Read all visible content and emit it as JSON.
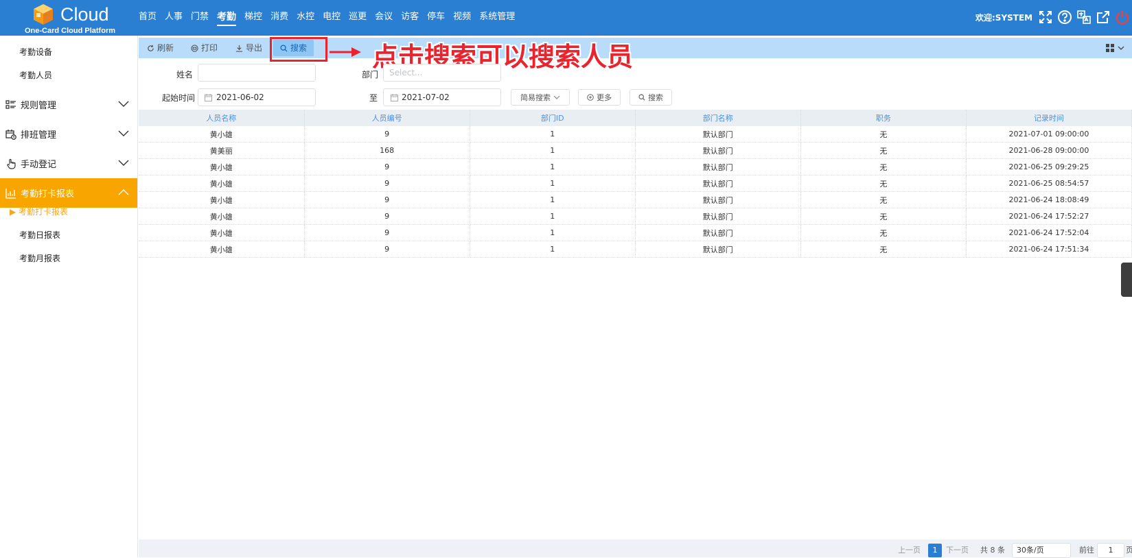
{
  "brand": {
    "name": "Cloud",
    "subtitle": "One-Card Cloud Platform"
  },
  "nav": {
    "items": [
      "首页",
      "人事",
      "门禁",
      "考勤",
      "梯控",
      "消费",
      "水控",
      "电控",
      "巡更",
      "会议",
      "访客",
      "停车",
      "视频",
      "系统管理"
    ],
    "active": "考勤"
  },
  "header": {
    "welcome": "欢迎:SYSTEM"
  },
  "sidebar": {
    "top_items": [
      "考勤设备",
      "考勤人员"
    ],
    "groups": [
      "规则管理",
      "排班管理",
      "手动登记"
    ],
    "active_group": "考勤打卡报表",
    "active_sub": "考勤打卡报表",
    "sub_items": [
      "考勤日报表",
      "考勤月报表"
    ]
  },
  "toolbar": {
    "refresh": "刷新",
    "print": "打印",
    "export": "导出",
    "search": "搜索"
  },
  "annotation": {
    "text": "点击搜索可以搜索人员",
    "color": "#e8242f"
  },
  "filters": {
    "name_label": "姓名",
    "name_value": "",
    "dept_label": "部门",
    "dept_placeholder": "Select...",
    "start_label": "起始时间",
    "start_value": "2021-06-02",
    "to_label": "至",
    "end_value": "2021-07-02",
    "mode": "简易搜索",
    "more": "更多",
    "search": "搜索"
  },
  "table": {
    "columns": [
      "人员名称",
      "人员编号",
      "部门ID",
      "部门名称",
      "职务",
      "记录时间"
    ],
    "rows": [
      [
        "黄小雄",
        "9",
        "1",
        "默认部门",
        "无",
        "2021-07-01 09:00:00"
      ],
      [
        "黄美丽",
        "168",
        "1",
        "默认部门",
        "无",
        "2021-06-28 09:00:00"
      ],
      [
        "黄小雄",
        "9",
        "1",
        "默认部门",
        "无",
        "2021-06-25 09:29:25"
      ],
      [
        "黄小雄",
        "9",
        "1",
        "默认部门",
        "无",
        "2021-06-25 08:54:57"
      ],
      [
        "黄小雄",
        "9",
        "1",
        "默认部门",
        "无",
        "2021-06-24 18:08:49"
      ],
      [
        "黄小雄",
        "9",
        "1",
        "默认部门",
        "无",
        "2021-06-24 17:52:27"
      ],
      [
        "黄小雄",
        "9",
        "1",
        "默认部门",
        "无",
        "2021-06-24 17:52:04"
      ],
      [
        "黄小雄",
        "9",
        "1",
        "默认部门",
        "无",
        "2021-06-24 17:51:34"
      ]
    ]
  },
  "pagination": {
    "prev": "上一页",
    "current": "1",
    "next": "下一页",
    "total": "共 8 条",
    "page_size": "30条/页",
    "goto_label": "前往",
    "goto_value": "1",
    "page_suffix": "页"
  },
  "colors": {
    "header_bg": "#2b7fd3",
    "active_group": "#f9a500",
    "toolbar_bg": "#b9dcfb"
  }
}
